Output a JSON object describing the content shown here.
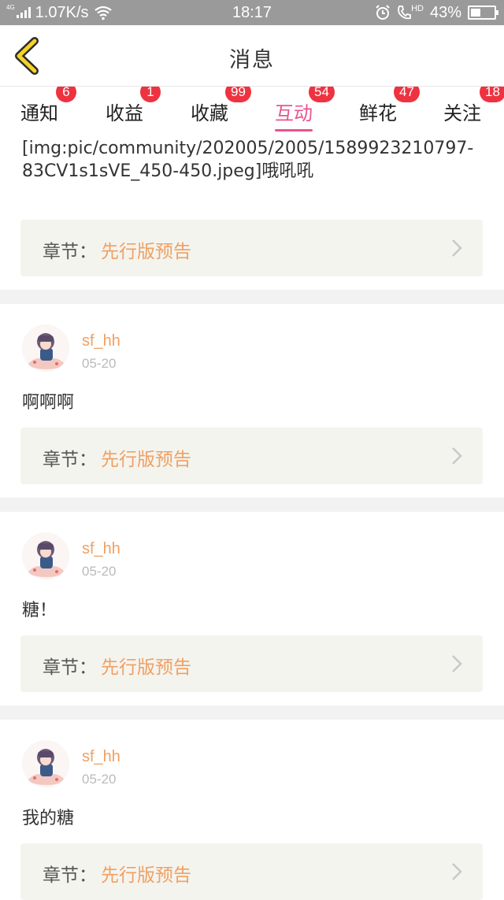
{
  "status_bar": {
    "network": "4G",
    "speed": "1.07K/s",
    "time": "18:17",
    "hd": "HD",
    "battery": "43%"
  },
  "header": {
    "back_icon": "chevron-left-icon",
    "title": "消息"
  },
  "tabs": [
    {
      "label": "通知",
      "badge": "6",
      "active": false
    },
    {
      "label": "收益",
      "badge": "1",
      "active": false
    },
    {
      "label": "收藏",
      "badge": "99",
      "active": false
    },
    {
      "label": "互动",
      "badge": "54",
      "active": true
    },
    {
      "label": "鲜花",
      "badge": "47",
      "active": false
    },
    {
      "label": "关注",
      "badge": "18",
      "active": false
    }
  ],
  "first_item": {
    "text": "[img:pic/community/202005/2005/1589923210797-83CV1s1sVE_450-450.jpeg]哦吼吼",
    "chapter_label": "章节：",
    "chapter_value": "先行版预告"
  },
  "items": [
    {
      "user": "sf_hh",
      "date": "05-20",
      "text": "啊啊啊",
      "chapter_label": "章节：",
      "chapter_value": "先行版预告"
    },
    {
      "user": "sf_hh",
      "date": "05-20",
      "text": "糖！",
      "chapter_label": "章节：",
      "chapter_value": "先行版预告"
    },
    {
      "user": "sf_hh",
      "date": "05-20",
      "text": "我的糖",
      "chapter_label": "章节：",
      "chapter_value": "先行版预告"
    }
  ],
  "colors": {
    "accent": "#e8538e",
    "badge": "#ee3340",
    "chapter_value": "#f0a062",
    "back": "#f5d327"
  }
}
